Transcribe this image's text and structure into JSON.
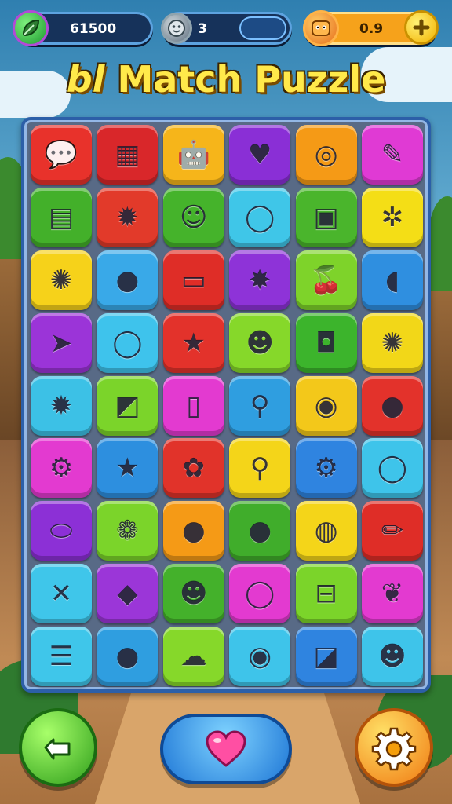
{
  "header": {
    "score_value": "61500",
    "moves_value": "3",
    "coins_value": "0.9",
    "score_icon": "leaf-icon",
    "moves_icon": "face-icon",
    "coins_icon": "coin-face-icon",
    "add_icon": "plus-icon"
  },
  "title": {
    "prefix": "bl",
    "text": "Match Puzzle"
  },
  "board": {
    "rows": [
      [
        {
          "color": "#e8322b",
          "icon": "speech-bubble-icon",
          "glyph": "💬"
        },
        {
          "color": "#d9272a",
          "icon": "calendar-icon",
          "glyph": "▦"
        },
        {
          "color": "#f6b51a",
          "icon": "robot-face-icon",
          "glyph": "🤖"
        },
        {
          "color": "#8a2fd6",
          "icon": "heart-bird-icon",
          "glyph": "♥"
        },
        {
          "color": "#f59a16",
          "icon": "ring-icon",
          "glyph": "◎"
        },
        {
          "color": "#e03ad4",
          "icon": "brush-icon",
          "glyph": "✎"
        }
      ],
      [
        {
          "color": "#43b02a",
          "icon": "treasure-chest-icon",
          "glyph": "▤"
        },
        {
          "color": "#e23a2a",
          "icon": "sun-face-icon",
          "glyph": "✹"
        },
        {
          "color": "#45b32b",
          "icon": "smiley-icon",
          "glyph": "☺"
        },
        {
          "color": "#3fc6e8",
          "icon": "magnifier-icon",
          "glyph": "◯"
        },
        {
          "color": "#4ab52c",
          "icon": "crate-icon",
          "glyph": "▣"
        },
        {
          "color": "#f4de16",
          "icon": "gear-ring-icon",
          "glyph": "✲"
        }
      ],
      [
        {
          "color": "#f6d21a",
          "icon": "alien-icon",
          "glyph": "✺"
        },
        {
          "color": "#39a9e8",
          "icon": "leaf-bubble-icon",
          "glyph": "●"
        },
        {
          "color": "#df2d27",
          "icon": "ticket-icon",
          "glyph": "▭"
        },
        {
          "color": "#8e33d8",
          "icon": "star-badge-icon",
          "glyph": "✸"
        },
        {
          "color": "#7ed32a",
          "icon": "cherry-icon",
          "glyph": "🍒"
        },
        {
          "color": "#2f8fe0",
          "icon": "fish-icon",
          "glyph": "◖"
        }
      ],
      [
        {
          "color": "#9b34d8",
          "icon": "arrow-star-icon",
          "glyph": "➤"
        },
        {
          "color": "#3ec3ec",
          "icon": "chat-ring-icon",
          "glyph": "◯"
        },
        {
          "color": "#e3322b",
          "icon": "star-icon",
          "glyph": "★"
        },
        {
          "color": "#86d82a",
          "icon": "blob-face-icon",
          "glyph": "☻"
        },
        {
          "color": "#3cb42c",
          "icon": "gift-icon",
          "glyph": "◘"
        },
        {
          "color": "#f2d718",
          "icon": "virus-icon",
          "glyph": "✺"
        }
      ],
      [
        {
          "color": "#3cc1e6",
          "icon": "burst-icon",
          "glyph": "✹"
        },
        {
          "color": "#7bd42a",
          "icon": "chart-icon",
          "glyph": "◩"
        },
        {
          "color": "#e33ad0",
          "icon": "battery-icon",
          "glyph": "▯"
        },
        {
          "color": "#2f9ee0",
          "icon": "search-icon",
          "glyph": "⚲"
        },
        {
          "color": "#f3c81a",
          "icon": "monster-icon",
          "glyph": "◉"
        },
        {
          "color": "#e3322b",
          "icon": "tomato-icon",
          "glyph": "●"
        }
      ],
      [
        {
          "color": "#e33ad0",
          "icon": "cog-icon",
          "glyph": "⚙"
        },
        {
          "color": "#2d8fdf",
          "icon": "star-face-icon",
          "glyph": "★"
        },
        {
          "color": "#e1332a",
          "icon": "flower-chart-icon",
          "glyph": "✿"
        },
        {
          "color": "#f4d519",
          "icon": "pin-icon",
          "glyph": "⚲"
        },
        {
          "color": "#2f84e0",
          "icon": "gear-icon",
          "glyph": "⚙"
        },
        {
          "color": "#3ec4ea",
          "icon": "ring-icon",
          "glyph": "◯"
        }
      ],
      [
        {
          "color": "#8c30d6",
          "icon": "pill-icon",
          "glyph": "⬭"
        },
        {
          "color": "#7bd42a",
          "icon": "flower-gear-icon",
          "glyph": "❁"
        },
        {
          "color": "#f59a16",
          "icon": "lollipop-icon",
          "glyph": "●"
        },
        {
          "color": "#40ad2b",
          "icon": "leaf-circle-icon",
          "glyph": "●"
        },
        {
          "color": "#f4d519",
          "icon": "lemon-icon",
          "glyph": "◍"
        },
        {
          "color": "#df2d27",
          "icon": "pencil-icon",
          "glyph": "✏"
        }
      ],
      [
        {
          "color": "#3fc6ea",
          "icon": "cross-icon",
          "glyph": "✕"
        },
        {
          "color": "#9b36d8",
          "icon": "drill-icon",
          "glyph": "◆"
        },
        {
          "color": "#44b12b",
          "icon": "slime-face-icon",
          "glyph": "☻"
        },
        {
          "color": "#e33ad0",
          "icon": "lens-icon",
          "glyph": "◯"
        },
        {
          "color": "#7bd42a",
          "icon": "basket-icon",
          "glyph": "⊟"
        },
        {
          "color": "#e33ad0",
          "icon": "leaf-icon",
          "glyph": "❦"
        }
      ],
      [
        {
          "color": "#3fc6ea",
          "icon": "notebook-icon",
          "glyph": "☰"
        },
        {
          "color": "#2f9ee0",
          "icon": "chat-bubble-icon",
          "glyph": "●"
        },
        {
          "color": "#86d82a",
          "icon": "cloud-bubble-icon",
          "glyph": "☁"
        },
        {
          "color": "#3ec4ea",
          "icon": "feather-ball-icon",
          "glyph": "◉"
        },
        {
          "color": "#2f84e0",
          "icon": "edit-square-icon",
          "glyph": "◪"
        },
        {
          "color": "#3ec4ea",
          "icon": "frog-chat-icon",
          "glyph": "☻"
        }
      ]
    ]
  },
  "controls": {
    "back_icon": "back-arrow-icon",
    "heart_icon": "heart-icon",
    "settings_icon": "gear-icon"
  }
}
